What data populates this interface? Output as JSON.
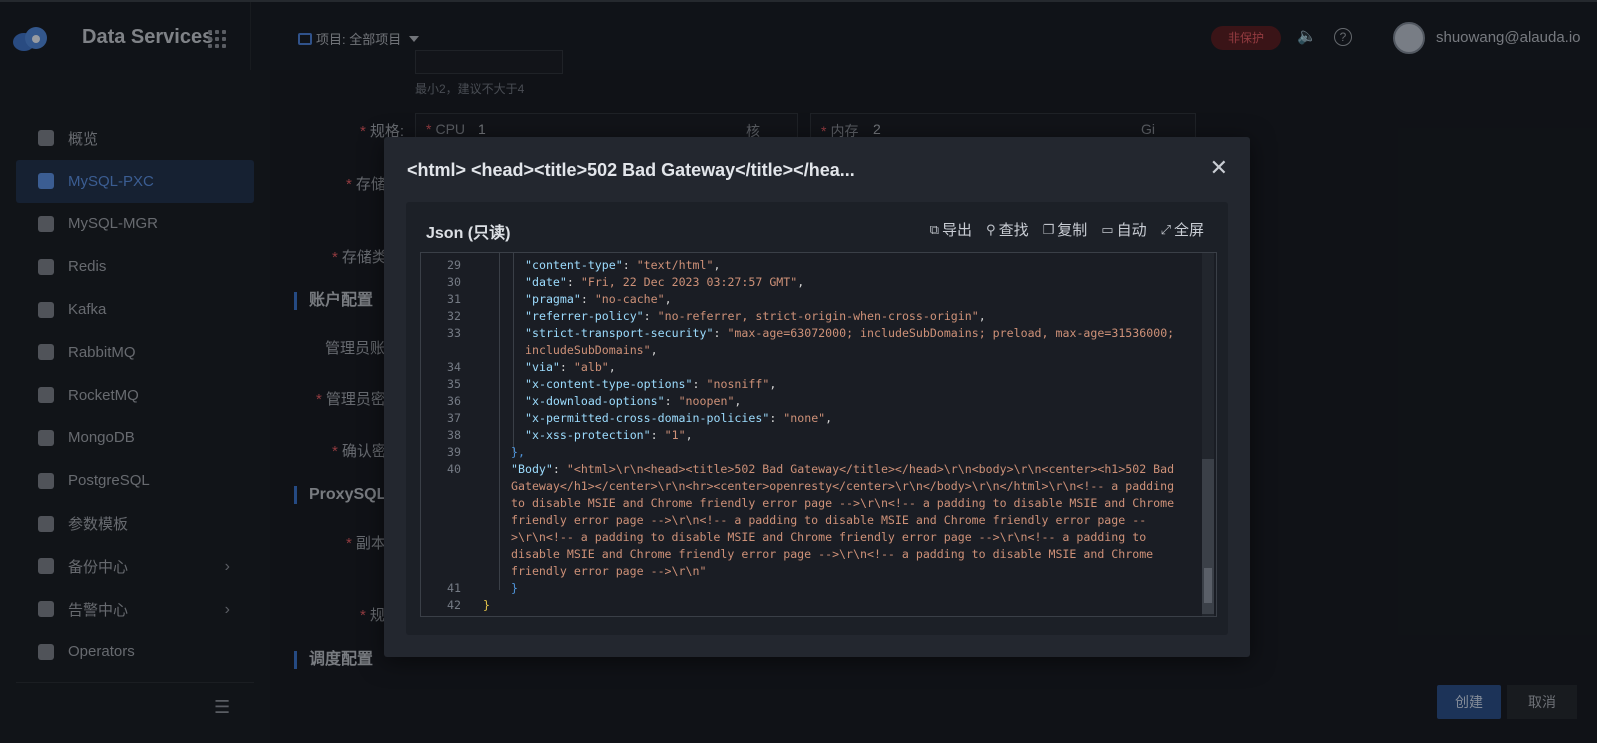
{
  "topbar": {
    "brand": "Data Services",
    "project_label": "项目: 全部项目",
    "badge": "非保护",
    "user": "shuowang@alauda.io"
  },
  "sidebar": {
    "items": [
      {
        "label": "概览",
        "icon": "chart-icon"
      },
      {
        "label": "MySQL-PXC",
        "icon": "dolphin-icon",
        "active": true
      },
      {
        "label": "MySQL-MGR",
        "icon": "dolphin-icon"
      },
      {
        "label": "Redis",
        "icon": "layers-icon"
      },
      {
        "label": "Kafka",
        "icon": "kafka-icon"
      },
      {
        "label": "RabbitMQ",
        "icon": "rabbit-icon"
      },
      {
        "label": "RocketMQ",
        "icon": "rocket-icon"
      },
      {
        "label": "MongoDB",
        "icon": "leaf-icon"
      },
      {
        "label": "PostgreSQL",
        "icon": "elephant-icon"
      },
      {
        "label": "参数模板",
        "icon": "template-icon"
      },
      {
        "label": "备份中心",
        "icon": "backup-icon",
        "expand": true
      },
      {
        "label": "告警中心",
        "icon": "alarm-icon",
        "expand": true
      },
      {
        "label": "Operators",
        "icon": "operators-icon"
      }
    ]
  },
  "form": {
    "hint": "最小2，建议不大于4",
    "spec_label": "规格:",
    "cpu_label": "CPU",
    "cpu_value": "1",
    "cpu_unit": "核",
    "mem_label": "内存",
    "mem_value": "2",
    "mem_unit": "Gi",
    "storage_label": "存储",
    "storage_class_label": "存储类",
    "account_section": "账户配置",
    "admin_user_label": "管理员账号",
    "admin_pwd_label": "管理员密码",
    "confirm_pwd_label": "确认密码",
    "proxy_section": "ProxySQL",
    "replica_label": "副本",
    "spec2_label": "规格",
    "schedule_section": "调度配置",
    "create_button": "创建",
    "cancel_button": "取消"
  },
  "modal": {
    "title": "<html> <head><title>502 Bad Gateway</title></hea...",
    "panel_title": "Json (只读)",
    "toolbar": {
      "export": "导出",
      "search": "查找",
      "copy": "复制",
      "auto": "自动",
      "fullscreen": "全屏"
    },
    "code_lines": [
      {
        "n": "29",
        "k": "\"content-type\"",
        "v": "\"text/html\""
      },
      {
        "n": "30",
        "k": "\"date\"",
        "v": "\"Fri, 22 Dec 2023 03:27:57 GMT\""
      },
      {
        "n": "31",
        "k": "\"pragma\"",
        "v": "\"no-cache\""
      },
      {
        "n": "32",
        "k": "\"referrer-policy\"",
        "v": "\"no-referrer, strict-origin-when-cross-origin\""
      },
      {
        "n": "33",
        "k": "\"strict-transport-security\"",
        "v": "\"max-age=63072000; includeSubDomains; preload, max-age=31536000; includeSubDomains\""
      },
      {
        "n": "34",
        "k": "\"via\"",
        "v": "\"alb\""
      },
      {
        "n": "35",
        "k": "\"x-content-type-options\"",
        "v": "\"nosniff\""
      },
      {
        "n": "36",
        "k": "\"x-download-options\"",
        "v": "\"noopen\""
      },
      {
        "n": "37",
        "k": "\"x-permitted-cross-domain-policies\"",
        "v": "\"none\""
      },
      {
        "n": "38",
        "k": "\"x-xss-protection\"",
        "v": "\"1\""
      }
    ],
    "line39": "39",
    "line39_text": "},",
    "line40": "40",
    "body_key": "\"Body\"",
    "body_value": "\"<html>\\r\\n<head><title>502 Bad Gateway</title></head>\\r\\n<body>\\r\\n<center><h1>502 Bad Gateway</h1></center>\\r\\n<hr><center>openresty</center>\\r\\n</body>\\r\\n</html>\\r\\n<!-- a padding to disable MSIE and Chrome friendly error page -->\\r\\n<!-- a padding to disable MSIE and Chrome friendly error page -->\\r\\n<!-- a padding to disable MSIE and Chrome friendly error page -->\\r\\n<!-- a padding to disable MSIE and Chrome friendly error page -->\\r\\n<!-- a padding to disable MSIE and Chrome friendly error page -->\\r\\n<!-- a padding to disable MSIE and Chrome friendly error page -->\\r\\n\"",
    "line41": "41",
    "line41_text": "}",
    "line42": "42",
    "line42_text": "}"
  }
}
